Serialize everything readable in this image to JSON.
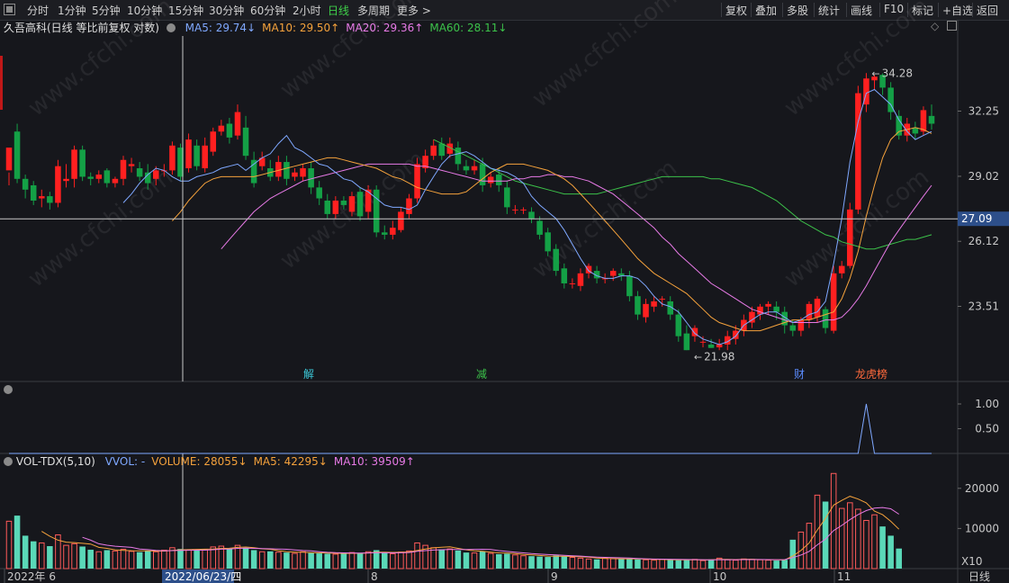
{
  "toolbar": {
    "periods": [
      "分时",
      "1分钟",
      "5分钟",
      "10分钟",
      "15分钟",
      "30分钟",
      "60分钟",
      "2小时",
      "日线",
      "多周期",
      "更多 >"
    ],
    "active_period": "日线",
    "tools": [
      "复权",
      "叠加",
      "多股",
      "统计",
      "画线",
      "F10",
      "标记",
      "+自选",
      "返回"
    ]
  },
  "main_legend": {
    "title": "久吾高科(日线 等比前复权 对数)",
    "ma": [
      {
        "label": "MA5: 29.74↓",
        "color": "#7fa8ff"
      },
      {
        "label": "MA10: 29.50↑",
        "color": "#f5a23c"
      },
      {
        "label": "MA20: 29.36↑",
        "color": "#e77ae6"
      },
      {
        "label": "MA60: 28.11↓",
        "color": "#3cc24a"
      }
    ]
  },
  "vol_legend": {
    "title": "VOL-TDX(5,10)",
    "items": [
      {
        "label": "VVOL: -",
        "color": "#7fa8ff"
      },
      {
        "label": "VOLUME: 28055↓",
        "color": "#f5a23c"
      },
      {
        "label": "MA5: 42295↓",
        "color": "#f5a23c"
      },
      {
        "label": "MA10: 39509↑",
        "color": "#e77ae6"
      }
    ]
  },
  "price_axis": [
    "32.25",
    "29.02",
    "26.12",
    "23.51"
  ],
  "crosshair_price": "27.09",
  "indicator_axis": [
    "1.00",
    "0.50"
  ],
  "volume_axis": [
    "20000",
    "10000"
  ],
  "volume_unit": "X10",
  "date_axis": [
    "2022年 6",
    "8",
    "9",
    "10",
    "11"
  ],
  "crosshair_date": "2022/06/23/四",
  "period_label": "日线",
  "annotations": {
    "high": "34.28",
    "low": "21.98",
    "events": [
      {
        "label": "解",
        "color": "#3cc8d8"
      },
      {
        "label": "减",
        "color": "#3cc24a"
      },
      {
        "label": "财",
        "color": "#5b8cff"
      },
      {
        "label": "龙虎榜",
        "color": "#ff6a3c"
      }
    ]
  },
  "watermark": "www.cfchi.com",
  "colors": {
    "up": "#ff2020",
    "down": "#14a046",
    "vol_up": "#ff5a5a",
    "vol_down": "#5ad8b8",
    "ma5": "#7fa8ff",
    "ma10": "#f5a23c",
    "ma20": "#e77ae6",
    "ma60": "#3cc24a",
    "crosshair": "#c8c8c8"
  },
  "chart_data": {
    "type": "candlestick",
    "log_scale": true,
    "ylim": [
      21.0,
      36.0
    ],
    "candles": [
      [
        29.3,
        30.4,
        29.2,
        28.6
      ],
      [
        31.2,
        28.9,
        31.6,
        28.7
      ],
      [
        28.9,
        28.4,
        29.1,
        28.0
      ],
      [
        28.6,
        27.9,
        28.8,
        27.7
      ],
      [
        28.0,
        28.1,
        28.4,
        27.6
      ],
      [
        28.1,
        27.8,
        28.3,
        27.5
      ],
      [
        27.8,
        29.5,
        29.8,
        27.6
      ],
      [
        28.8,
        28.9,
        29.6,
        28.5
      ],
      [
        28.9,
        30.3,
        30.5,
        28.5
      ],
      [
        30.3,
        29.0,
        30.5,
        28.8
      ],
      [
        29.0,
        28.9,
        29.2,
        28.6
      ],
      [
        28.9,
        29.1,
        29.3,
        28.7
      ],
      [
        29.3,
        28.7,
        29.4,
        28.5
      ],
      [
        28.7,
        28.9,
        29.0,
        28.5
      ],
      [
        28.9,
        29.8,
        30.0,
        28.6
      ],
      [
        29.5,
        29.6,
        29.9,
        29.2
      ],
      [
        29.4,
        29.0,
        29.7,
        28.8
      ],
      [
        29.2,
        28.7,
        29.6,
        28.4
      ],
      [
        28.9,
        29.3,
        29.5,
        28.6
      ],
      [
        29.3,
        29.3,
        29.6,
        29.0
      ],
      [
        29.3,
        30.5,
        30.7,
        29.1
      ],
      [
        30.4,
        29.0,
        30.6,
        28.8
      ],
      [
        29.4,
        30.8,
        31.1,
        29.2
      ],
      [
        30.5,
        29.5,
        30.8,
        29.3
      ],
      [
        29.4,
        30.5,
        30.9,
        29.2
      ],
      [
        30.2,
        31.2,
        31.4,
        30.0
      ],
      [
        31.2,
        31.5,
        31.8,
        31.0
      ],
      [
        31.6,
        30.9,
        31.9,
        30.6
      ],
      [
        31.0,
        32.2,
        32.6,
        30.8
      ],
      [
        31.4,
        30.0,
        32.0,
        29.8
      ],
      [
        29.8,
        28.7,
        30.2,
        28.5
      ],
      [
        29.5,
        29.9,
        30.2,
        29.3
      ],
      [
        29.4,
        29.0,
        29.8,
        28.8
      ],
      [
        29.0,
        29.7,
        30.0,
        28.8
      ],
      [
        29.7,
        28.9,
        30.0,
        28.6
      ],
      [
        29.0,
        29.2,
        29.4,
        28.8
      ],
      [
        29.0,
        29.4,
        29.6,
        28.8
      ],
      [
        29.4,
        28.5,
        29.7,
        28.2
      ],
      [
        28.5,
        28.0,
        28.8,
        27.7
      ],
      [
        27.9,
        27.3,
        28.2,
        27.1
      ],
      [
        27.3,
        27.9,
        28.1,
        27.1
      ],
      [
        27.9,
        27.7,
        28.1,
        27.5
      ],
      [
        27.4,
        28.1,
        28.3,
        27.2
      ],
      [
        28.3,
        27.2,
        28.5,
        27.0
      ],
      [
        27.4,
        28.4,
        28.6,
        27.1
      ],
      [
        28.4,
        26.5,
        28.6,
        26.3
      ],
      [
        26.5,
        26.4,
        26.8,
        26.2
      ],
      [
        26.4,
        26.7,
        27.0,
        26.2
      ],
      [
        26.6,
        27.4,
        27.6,
        26.5
      ],
      [
        27.3,
        28.0,
        28.2,
        27.1
      ],
      [
        28.0,
        29.6,
        29.9,
        27.8
      ],
      [
        29.4,
        30.0,
        30.3,
        29.2
      ],
      [
        30.0,
        30.5,
        30.8,
        29.8
      ],
      [
        30.6,
        30.0,
        30.9,
        29.8
      ],
      [
        30.1,
        30.6,
        30.9,
        29.9
      ],
      [
        30.4,
        29.6,
        30.7,
        29.3
      ],
      [
        29.5,
        29.3,
        29.8,
        29.1
      ],
      [
        29.3,
        29.5,
        29.8,
        29.1
      ],
      [
        29.6,
        28.6,
        29.9,
        28.3
      ],
      [
        28.7,
        29.0,
        29.2,
        28.5
      ],
      [
        29.1,
        28.6,
        29.4,
        28.3
      ],
      [
        28.5,
        27.6,
        28.8,
        27.3
      ],
      [
        27.5,
        27.5,
        27.7,
        27.3
      ],
      [
        27.5,
        27.5,
        27.6,
        27.3
      ],
      [
        27.4,
        27.1,
        27.6,
        26.9
      ],
      [
        27.0,
        26.4,
        27.2,
        26.2
      ],
      [
        26.5,
        25.7,
        26.7,
        25.5
      ],
      [
        25.8,
        24.9,
        26.0,
        24.7
      ],
      [
        25.0,
        24.4,
        25.2,
        24.2
      ],
      [
        24.4,
        24.4,
        24.6,
        24.2
      ],
      [
        24.3,
        24.8,
        25.0,
        24.1
      ],
      [
        24.8,
        25.1,
        25.2,
        24.6
      ],
      [
        24.9,
        24.6,
        25.1,
        24.4
      ],
      [
        24.6,
        24.6,
        24.8,
        24.4
      ],
      [
        24.7,
        24.9,
        25.0,
        24.5
      ],
      [
        24.8,
        24.7,
        25.0,
        24.5
      ],
      [
        24.7,
        23.9,
        24.9,
        23.7
      ],
      [
        23.9,
        23.2,
        24.1,
        23.0
      ],
      [
        23.1,
        23.6,
        23.8,
        22.9
      ],
      [
        23.5,
        23.7,
        23.9,
        23.3
      ],
      [
        23.8,
        23.8,
        23.9,
        23.5
      ],
      [
        23.7,
        23.2,
        23.9,
        23.0
      ],
      [
        23.2,
        22.4,
        23.4,
        22.2
      ],
      [
        22.5,
        21.9,
        22.8,
        21.9
      ],
      [
        22.4,
        22.7,
        22.8,
        22.2
      ],
      [
        22.2,
        22.2,
        22.4,
        22.0
      ],
      [
        22.1,
        21.98,
        22.3,
        21.98
      ],
      [
        22.0,
        22.1,
        22.3,
        21.9
      ],
      [
        22.1,
        22.4,
        22.6,
        21.9
      ],
      [
        22.3,
        22.6,
        22.8,
        22.1
      ],
      [
        22.6,
        23.0,
        23.2,
        22.4
      ],
      [
        22.9,
        23.3,
        23.5,
        22.7
      ],
      [
        23.2,
        23.5,
        23.6,
        23.0
      ],
      [
        23.5,
        23.6,
        23.7,
        23.2
      ],
      [
        23.5,
        23.3,
        23.7,
        23.0
      ],
      [
        23.3,
        22.8,
        23.5,
        22.5
      ],
      [
        22.8,
        22.6,
        23.0,
        22.4
      ],
      [
        22.6,
        23.0,
        23.1,
        22.4
      ],
      [
        23.0,
        23.6,
        23.7,
        22.7
      ],
      [
        23.1,
        23.8,
        23.9,
        22.9
      ],
      [
        23.4,
        22.7,
        23.5,
        22.5
      ],
      [
        22.6,
        24.8,
        25.1,
        22.5
      ],
      [
        24.8,
        25.1,
        25.3,
        24.6
      ],
      [
        25.1,
        27.5,
        27.8,
        25.0
      ],
      [
        27.5,
        33.2,
        33.6,
        27.3
      ],
      [
        32.6,
        34.0,
        34.3,
        32.2
      ],
      [
        33.9,
        34.1,
        34.2,
        33.4
      ],
      [
        34.2,
        33.5,
        34.28,
        33.1
      ],
      [
        33.5,
        32.2,
        33.8,
        31.8
      ],
      [
        32.0,
        31.0,
        32.3,
        30.8
      ],
      [
        31.0,
        31.6,
        31.9,
        30.7
      ],
      [
        31.4,
        31.1,
        31.7,
        30.8
      ],
      [
        31.2,
        32.3,
        32.5,
        31.0
      ],
      [
        32.0,
        31.6,
        32.6,
        31.3
      ]
    ],
    "ma5": [
      27.8,
      28.2,
      28.7,
      29.1,
      29.4,
      29.3,
      29.0,
      28.8,
      28.8,
      29.0,
      29.1,
      29.2,
      29.4,
      29.5,
      29.6,
      29.3,
      29.6,
      29.9,
      30.1,
      30.6,
      31.0,
      30.4,
      30.2,
      29.9,
      29.6,
      29.5,
      29.2,
      28.9,
      28.8,
      28.5,
      28.3,
      28.0,
      27.7,
      27.6,
      27.6,
      27.5,
      27.7,
      28.4,
      29.0,
      29.6,
      30.0,
      30.1,
      30.2,
      30.0,
      29.7,
      29.4,
      29.3,
      29.2,
      29.0,
      28.7,
      28.1,
      27.7,
      27.4,
      27.1,
      26.6,
      26.0,
      25.4,
      24.9,
      24.7,
      24.6,
      24.6,
      24.7,
      24.7,
      24.6,
      24.3,
      23.9,
      23.6,
      23.5,
      23.3,
      22.9,
      22.5,
      22.3,
      22.2,
      22.1,
      22.2,
      22.4,
      22.8,
      23.0,
      23.2,
      23.3,
      23.3,
      23.1,
      22.9,
      23.0,
      23.2,
      23.3,
      23.7,
      25.2,
      27.1,
      29.7,
      31.7,
      33.2,
      33.4,
      33.0,
      32.6,
      31.8,
      31.2,
      30.8,
      31.0,
      31.2
    ],
    "ma10": [
      27.0,
      27.4,
      27.9,
      28.3,
      28.7,
      28.9,
      29.0,
      29.0,
      29.0,
      29.0,
      29.0,
      29.1,
      29.2,
      29.3,
      29.4,
      29.5,
      29.6,
      29.7,
      29.8,
      29.9,
      29.9,
      29.8,
      29.7,
      29.6,
      29.5,
      29.4,
      29.2,
      29.0,
      28.9,
      28.7,
      28.5,
      28.4,
      28.3,
      28.2,
      28.2,
      28.2,
      28.3,
      28.6,
      28.9,
      29.2,
      29.4,
      29.6,
      29.6,
      29.6,
      29.5,
      29.4,
      29.3,
      29.1,
      28.9,
      28.6,
      28.2,
      27.8,
      27.4,
      27.0,
      26.6,
      26.2,
      25.8,
      25.4,
      25.1,
      24.8,
      24.6,
      24.4,
      24.2,
      24.0,
      23.7,
      23.4,
      23.1,
      22.9,
      22.8,
      22.7,
      22.6,
      22.6,
      22.6,
      22.7,
      22.8,
      22.9,
      23.0,
      23.0,
      23.0,
      23.1,
      23.2,
      23.3,
      23.8,
      24.6,
      25.7,
      27.2,
      28.6,
      29.9,
      30.8,
      31.2,
      31.3,
      31.4,
      31.3,
      31.1
    ],
    "ma20": [
      25.8,
      26.2,
      26.6,
      27.0,
      27.4,
      27.7,
      28.0,
      28.2,
      28.4,
      28.6,
      28.8,
      28.9,
      29.0,
      29.1,
      29.2,
      29.3,
      29.4,
      29.5,
      29.6,
      29.6,
      29.6,
      29.6,
      29.6,
      29.6,
      29.5,
      29.5,
      29.4,
      29.3,
      29.2,
      29.1,
      29.0,
      28.9,
      28.8,
      28.8,
      28.8,
      28.8,
      28.9,
      28.9,
      29.0,
      29.0,
      29.1,
      29.1,
      29.0,
      29.0,
      28.9,
      28.8,
      28.6,
      28.4,
      28.2,
      27.9,
      27.6,
      27.3,
      27.0,
      26.7,
      26.3,
      26.0,
      25.6,
      25.3,
      25.0,
      24.7,
      24.4,
      24.2,
      24.0,
      23.8,
      23.6,
      23.4,
      23.3,
      23.2,
      23.1,
      23.0,
      22.9,
      22.9,
      22.9,
      22.9,
      23.0,
      23.0,
      23.1,
      23.4,
      23.8,
      24.3,
      24.9,
      25.5,
      26.1,
      26.6,
      27.1,
      27.6,
      28.1,
      28.6
    ],
    "ma60": [
      30.8,
      30.6,
      30.4,
      30.2,
      30.0,
      29.8,
      29.6,
      29.4,
      29.2,
      29.0,
      28.8,
      28.7,
      28.6,
      28.5,
      28.4,
      28.3,
      28.2,
      28.2,
      28.2,
      28.2,
      28.2,
      28.3,
      28.4,
      28.5,
      28.6,
      28.7,
      28.8,
      28.9,
      29.0,
      29.0,
      29.0,
      29.0,
      29.0,
      29.0,
      28.9,
      28.9,
      28.8,
      28.7,
      28.6,
      28.5,
      28.3,
      28.1,
      27.9,
      27.6,
      27.3,
      27.0,
      26.8,
      26.6,
      26.4,
      26.3,
      26.1,
      26.0,
      25.9,
      25.8,
      25.8,
      25.9,
      26.0,
      26.1,
      26.2,
      26.2,
      26.3,
      26.4
    ],
    "indicator": {
      "type": "line",
      "ylim": [
        0,
        1.2
      ],
      "spike_index": 105,
      "spike_value": 1.0
    },
    "volume": [
      11800,
      13200,
      8200,
      6800,
      6400,
      5600,
      8400,
      5800,
      6200,
      5500,
      4700,
      4200,
      4600,
      4400,
      4800,
      4300,
      4100,
      4500,
      4200,
      4600,
      5200,
      4900,
      4700,
      4600,
      4800,
      5400,
      5600,
      4900,
      5800,
      5200,
      4600,
      4200,
      4300,
      4100,
      4000,
      3800,
      4200,
      3900,
      3800,
      3700,
      3600,
      3900,
      4000,
      3800,
      4200,
      4600,
      3900,
      3700,
      4100,
      4400,
      6400,
      5800,
      5200,
      4800,
      4900,
      4500,
      4000,
      3900,
      4300,
      3800,
      3600,
      3700,
      3400,
      3200,
      3100,
      3000,
      2900,
      3300,
      3100,
      2800,
      2600,
      2400,
      2300,
      2600,
      2500,
      2400,
      2400,
      2300,
      2200,
      2100,
      2300,
      2200,
      2100,
      2200,
      2300,
      2000,
      2300,
      2600,
      2200,
      2100,
      2400,
      2300,
      2200,
      2100,
      2000,
      2200,
      7200,
      9100,
      11300,
      18300,
      16700,
      23700,
      15000,
      16400,
      14800,
      12000,
      13400,
      10500,
      8200,
      5000
    ],
    "volume_ylim": [
      0,
      26000
    ]
  }
}
